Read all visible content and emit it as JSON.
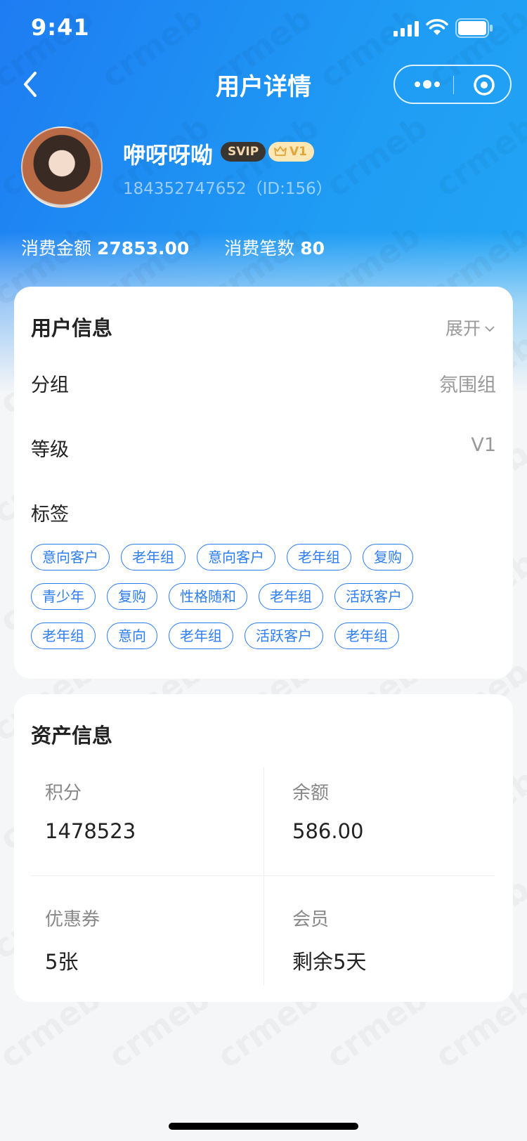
{
  "status_bar": {
    "time": "9:41"
  },
  "nav": {
    "title": "用户详情"
  },
  "profile": {
    "name": "咿呀呀呦",
    "svip_badge": "SVIP",
    "level_badge": "V1",
    "phone_id": "184352747652（ID:156）",
    "spend_amount_label": "消费金额",
    "spend_amount_value": "27853.00",
    "spend_count_label": "消费笔数",
    "spend_count_value": "80"
  },
  "user_info": {
    "title": "用户信息",
    "expand_label": "展开",
    "group_label": "分组",
    "group_value": "氛围组",
    "level_label": "等级",
    "level_value": "V1",
    "tags_label": "标签",
    "tags": [
      "意向客户",
      "老年组",
      "意向客户",
      "老年组",
      "复购",
      "青少年",
      "复购",
      "性格随和",
      "老年组",
      "活跃客户",
      "老年组",
      "意向",
      "老年组",
      "活跃客户",
      "老年组"
    ]
  },
  "asset_info": {
    "title": "资产信息",
    "points_label": "积分",
    "points_value": "1478523",
    "balance_label": "余额",
    "balance_value": "586.00",
    "coupon_label": "优惠券",
    "coupon_value": "5张",
    "member_label": "会员",
    "member_value": "剩余5天"
  },
  "watermark": "crmeb",
  "icons": [
    "signal-icon",
    "wifi-icon",
    "battery-icon",
    "back-icon",
    "more-icon",
    "target-icon",
    "crown-icon",
    "chevron-down-icon"
  ],
  "colors": {
    "brand": "#1f95f4",
    "tag": "#2d7df2",
    "svip_bg": "#3b3530",
    "v1_bg": "#fde7b4"
  }
}
